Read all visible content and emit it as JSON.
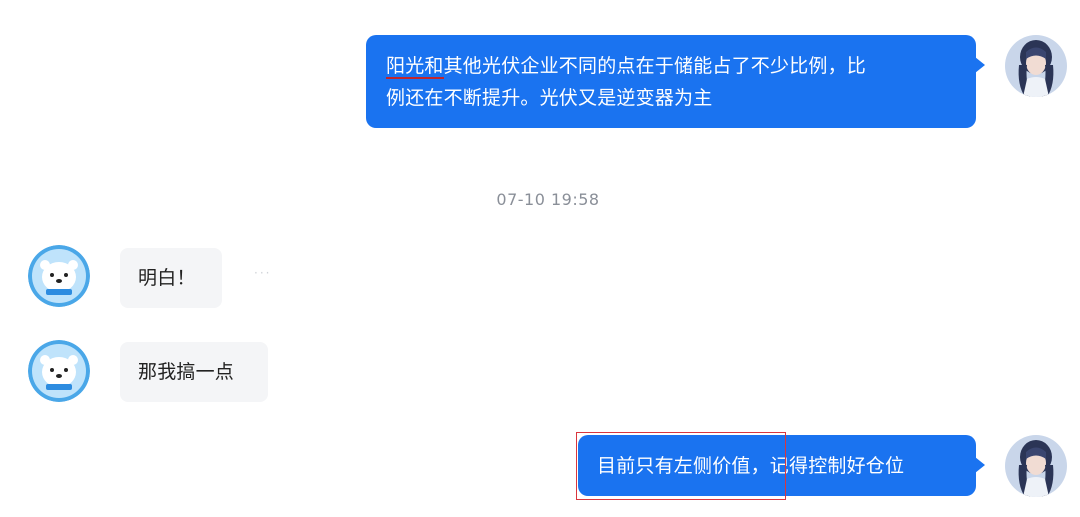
{
  "messages": {
    "m1": {
      "underlined": "阳光和",
      "rest_line1": "其他光伏企业不同的点在于储能占了不少比例，比",
      "line2": "例还在不断提升。光伏又是逆变器为主"
    },
    "timestamp": "07-10 19:58",
    "m2": "明白！",
    "m3": "那我搞一点",
    "m4": {
      "highlighted": "目前只有左侧价值",
      "rest": "，记得控制好仓位"
    }
  },
  "more_icon": "···",
  "colors": {
    "outgoing_bubble": "#1a73f0",
    "incoming_bubble": "#f4f5f7",
    "timestamp": "#8a8f98",
    "highlight_box": "#d9363e",
    "underline": "#c0262d"
  },
  "icons": {
    "self_avatar": "anime-girl-avatar",
    "other_avatar": "polar-bear-avatar"
  }
}
